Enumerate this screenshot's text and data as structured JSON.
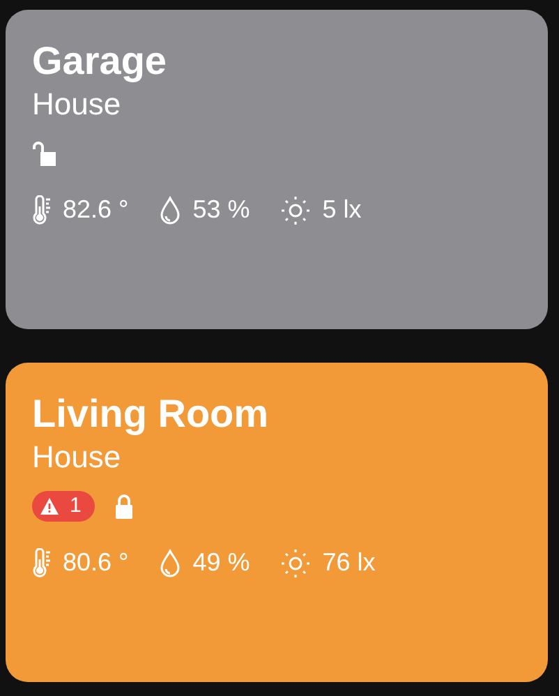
{
  "rooms": [
    {
      "name": "Garage",
      "home": "House",
      "color": "#8e8d92",
      "locked": false,
      "sensors": [
        {
          "kind": "temperature",
          "reading": "82.6 °"
        },
        {
          "kind": "humidity",
          "reading": "53 %"
        },
        {
          "kind": "light",
          "reading": "5 lx"
        }
      ]
    },
    {
      "name": "Living Room",
      "home": "House",
      "color": "#f19a37",
      "locked": true,
      "alert_count": "1",
      "sensors": [
        {
          "kind": "temperature",
          "reading": "80.6 °"
        },
        {
          "kind": "humidity",
          "reading": "49 %"
        },
        {
          "kind": "light",
          "reading": "76 lx"
        }
      ]
    }
  ]
}
